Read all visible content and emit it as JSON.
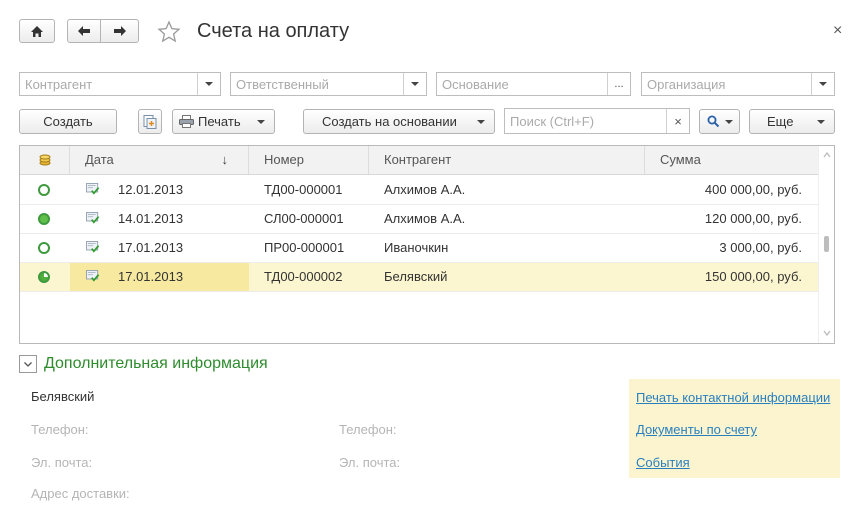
{
  "header": {
    "title": "Счета на оплату",
    "close_glyph": "×"
  },
  "filters": {
    "counterparty_placeholder": "Контрагент",
    "responsible_placeholder": "Ответственный",
    "basis_placeholder": "Основание",
    "basis_select_glyph": "...",
    "organization_placeholder": "Организация"
  },
  "toolbar": {
    "create_label": "Создать",
    "print_label": "Печать",
    "create_based_label": "Создать на основании",
    "search_placeholder": "Поиск (Ctrl+F)",
    "clear_glyph": "×",
    "more_label": "Еще"
  },
  "table": {
    "columns": [
      "Дата",
      "Номер",
      "Контрагент",
      "Сумма"
    ],
    "sort_glyph": "↓",
    "rows": [
      {
        "status": "open",
        "date": "12.01.2013",
        "number": "ТД00-000001",
        "counterparty": "Алхимов А.А.",
        "amount": "400 000,00, руб.",
        "selected": false
      },
      {
        "status": "paid",
        "date": "14.01.2013",
        "number": "СЛ00-000001",
        "counterparty": "Алхимов А.А.",
        "amount": "120 000,00, руб.",
        "selected": false
      },
      {
        "status": "open",
        "date": "17.01.2013",
        "number": "ПР00-000001",
        "counterparty": "Иваночкин",
        "amount": "3 000,00, руб.",
        "selected": false
      },
      {
        "status": "partial",
        "date": "17.01.2013",
        "number": "ТД00-000002",
        "counterparty": "Белявский",
        "amount": "150 000,00, руб.",
        "selected": true
      }
    ]
  },
  "details": {
    "toggle_glyph": "⌄",
    "title": "Дополнительная информация",
    "contact_name": "Белявский",
    "phone_label_1": "Телефон:",
    "phone_label_2": "Телефон:",
    "email_label_1": "Эл. почта:",
    "email_label_2": "Эл. почта:",
    "address_label": "Адрес доставки:",
    "links": [
      "Печать контактной информации",
      "Документы по счету",
      "События"
    ]
  },
  "colors": {
    "selected_row": "#fcf6d0",
    "selected_date_cell": "#f7e9a0",
    "links_panel": "#fbf4cf",
    "accent_green": "#2e8b2e",
    "link": "#2a7fbf"
  }
}
